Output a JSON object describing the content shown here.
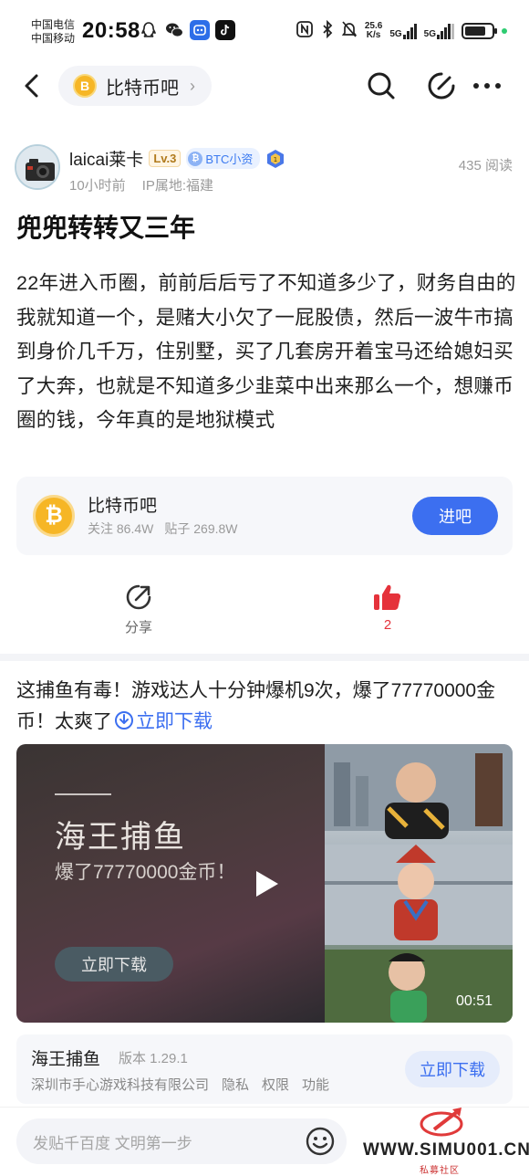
{
  "status_bar": {
    "carrier_1": "中国电信",
    "carrier_2": "中国移动",
    "time": "20:58",
    "speed_value": "25.6",
    "speed_unit": "K/s",
    "net_1": "5G",
    "net_2": "5G",
    "battery_level": 0.8
  },
  "nav": {
    "forum_name": "比特币吧",
    "coin_glyph": "B"
  },
  "post": {
    "author": "laicai莱卡",
    "level": "Lv.3",
    "tag": "BTC小资",
    "time_ago": "10小时前",
    "ip_location": "IP属地:福建",
    "reads": "435 阅读",
    "title": "兜兜转转又三年",
    "body": "22年进入币圈，前前后后亏了不知道多少了，财务自由的我就知道一个，是赌大小欠了一屁股债，然后一波牛市搞到身价几千万，住别墅，买了几套房开着宝马还给媳妇买了大奔，也就是不知道多少韭菜中出来那么一个，想赚币圈的钱，今年真的是地狱模式"
  },
  "forum_card": {
    "name": "比特币吧",
    "followers": "关注 86.4W",
    "posts": "贴子 269.8W",
    "join_label": "进吧"
  },
  "actions": {
    "share_label": "分享",
    "like_count": "2"
  },
  "ad": {
    "text": "这捕鱼有毒！游戏达人十分钟爆机9次，爆了77770000金币！太爽了",
    "link": "立即下载",
    "media_title": "海王捕鱼",
    "media_sub": "爆了77770000金币！",
    "media_cta": "立即下载",
    "duration": "00:51"
  },
  "app_info": {
    "name": "海王捕鱼",
    "version": "版本 1.29.1",
    "developer": "深圳市手心游戏科技有限公司",
    "privacy": "隐私",
    "permissions": "权限",
    "features": "功能",
    "download": "立即下载"
  },
  "bottom": {
    "reply_placeholder": "发贴千百度 文明第一步"
  },
  "watermark": {
    "site": "WWW.SIMU001.CN",
    "sub": "私募社区"
  },
  "colors": {
    "accent": "#3c6ff0",
    "like_red": "#e5323b",
    "coin_gold": "#f6b626"
  }
}
